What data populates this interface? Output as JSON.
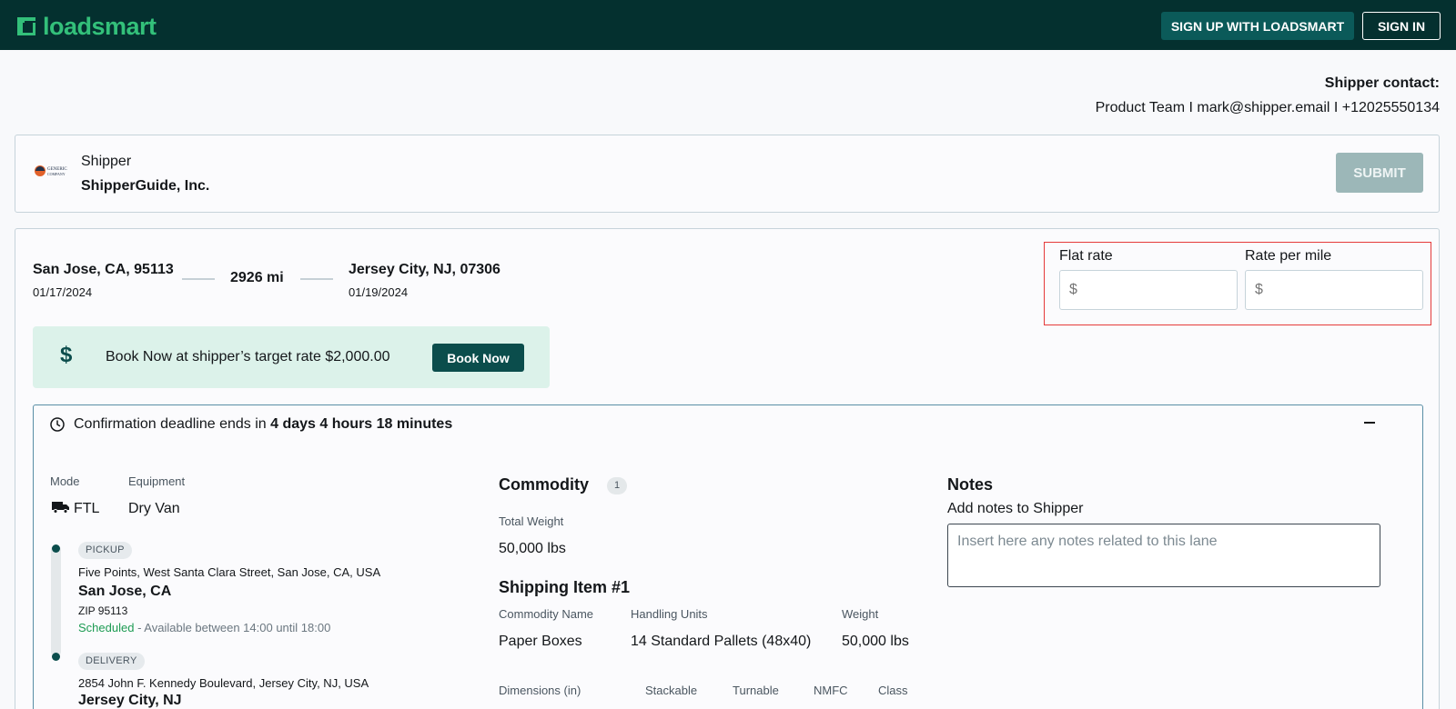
{
  "header": {
    "brand": "loadsmart",
    "signup_label": "SIGN UP WITH LOADSMART",
    "signin_label": "SIGN IN",
    "brand_color": "#33c07a",
    "bar_color": "#04302f"
  },
  "contact": {
    "title": "Shipper contact:",
    "line": "Product Team I mark@shipper.email I +12025550134"
  },
  "shipper": {
    "label": "Shipper",
    "name": "ShipperGuide, Inc.",
    "logo_text_1": "GENERIC",
    "logo_text_2": "COMPANY",
    "submit_label": "SUBMIT"
  },
  "lane": {
    "origin_city": "San Jose, CA, 95113",
    "origin_date": "01/17/2024",
    "distance": "2926 mi",
    "destination_city": "Jersey City, NJ, 07306",
    "destination_date": "01/19/2024"
  },
  "rates": {
    "flat_label": "Flat rate",
    "flat_placeholder": "$",
    "per_mile_label": "Rate per mile",
    "per_mile_placeholder": "$"
  },
  "booknow": {
    "icon": "dollar-icon",
    "text": "Book Now at shipper’s target rate $2,000.00",
    "button_label": "Book Now"
  },
  "deadline": {
    "prefix": "Confirmation deadline ends in ",
    "value": "4 days 4 hours 18 minutes"
  },
  "mode": {
    "mode_label": "Mode",
    "mode_value": "FTL",
    "equipment_label": "Equipment",
    "equipment_value": "Dry Van"
  },
  "stops": [
    {
      "tag": "PICKUP",
      "address": "Five Points, West Santa Clara Street, San Jose, CA, USA",
      "city": "San Jose, CA",
      "zip": "ZIP 95113",
      "status": "Scheduled",
      "window": " - Available between 14:00 until 18:00"
    },
    {
      "tag": "DELIVERY",
      "address": "2854 John F. Kennedy Boulevard, Jersey City, NJ, USA",
      "city": "Jersey City, NJ"
    }
  ],
  "commodity": {
    "title": "Commodity",
    "count": "1",
    "total_weight_label": "Total Weight",
    "total_weight_value": "50,000 lbs",
    "item_title": "Shipping Item #1",
    "name_label": "Commodity Name",
    "name_value": "Paper Boxes",
    "units_label": "Handling Units",
    "units_value": "14 Standard Pallets (48x40)",
    "weight_label": "Weight",
    "weight_value": "50,000 lbs",
    "dimensions_label": "Dimensions (in)",
    "stackable_label": "Stackable",
    "turnable_label": "Turnable",
    "nmfc_label": "NMFC",
    "class_label": "Class"
  },
  "notes": {
    "title": "Notes",
    "subtitle": "Add notes to Shipper",
    "placeholder": "Insert here any notes related to this lane"
  }
}
